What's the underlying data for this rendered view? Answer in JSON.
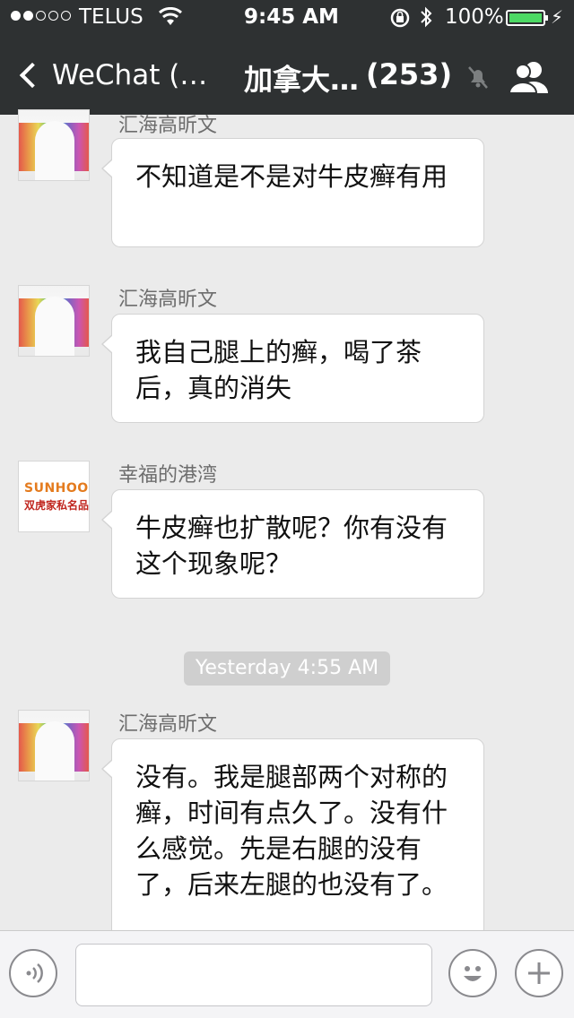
{
  "status_bar": {
    "carrier": "TELUS",
    "time": "9:45 AM",
    "battery": "100%",
    "battery_level": 1.0,
    "signal_bars_filled": 2,
    "signal_bars_total": 5
  },
  "nav": {
    "back_label": "WeChat (…",
    "title": "加拿大…",
    "member_count": "(253)",
    "icons": [
      "chevron-left-icon",
      "mute-icon",
      "group-members-icon"
    ]
  },
  "messages": [
    {
      "sender": "汇海高昕文",
      "text": "不知道是不是对牛皮癣有用",
      "avatar": "rainbow-arch-avatar"
    },
    {
      "sender": "汇海高昕文",
      "text": "我自己腿上的癣，喝了茶后，真的消失",
      "avatar": "rainbow-arch-avatar"
    },
    {
      "sender": "幸福的港湾",
      "text": "牛皮癣也扩散呢？你有没有这个现象呢？",
      "avatar": "sunhoo-logo-avatar"
    },
    {
      "sender": "汇海高昕文",
      "text": "没有。我是腿部两个对称的癣，时间有点久了。没有什么感觉。先是右腿的没有了，后来左腿的也没有了。",
      "avatar": "rainbow-arch-avatar"
    }
  ],
  "timestamp": "Yesterday 4:55 AM",
  "avatar_logo": {
    "brand": "SUNHOO",
    "subtitle": "双虎家私名品"
  },
  "input_bar": {
    "icons": [
      "voice-icon",
      "emoji-icon",
      "plus-icon"
    ]
  },
  "colors": {
    "nav_bg": "#2e3132",
    "chat_bg": "#ebebeb",
    "battery_fill": "#4cd964"
  }
}
